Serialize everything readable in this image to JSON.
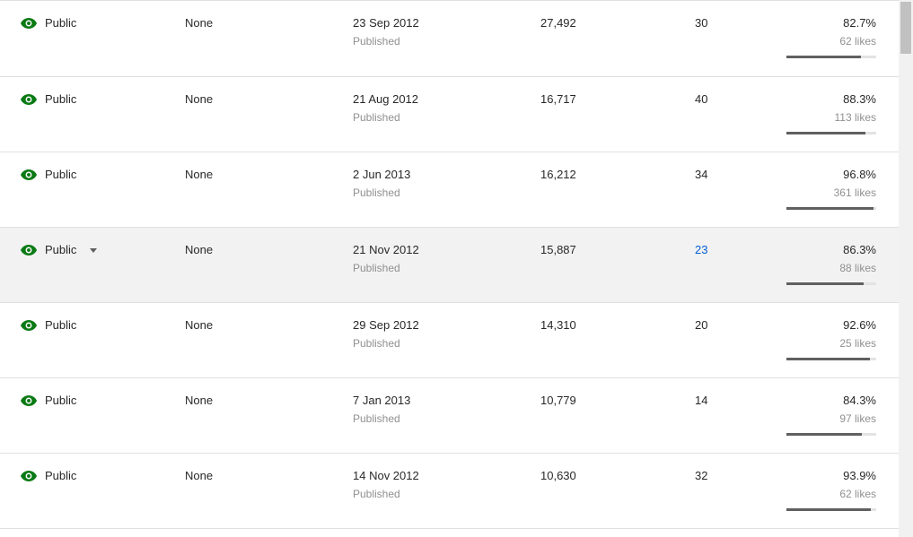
{
  "colors": {
    "visibility_icon": "#0b7a15",
    "link": "#065fd4",
    "hover_row": "#f2f2f2"
  },
  "rows": [
    {
      "visibility": "Public",
      "restrictions": "None",
      "date": "23 Sep 2012",
      "status": "Published",
      "views": "27,492",
      "comments": "30",
      "likes_pct": "82.7%",
      "likes_count": "62 likes",
      "ratio": 0.827
    },
    {
      "visibility": "Public",
      "restrictions": "None",
      "date": "21 Aug 2012",
      "status": "Published",
      "views": "16,717",
      "comments": "40",
      "likes_pct": "88.3%",
      "likes_count": "113 likes",
      "ratio": 0.883
    },
    {
      "visibility": "Public",
      "restrictions": "None",
      "date": "2 Jun 2013",
      "status": "Published",
      "views": "16,212",
      "comments": "34",
      "likes_pct": "96.8%",
      "likes_count": "361 likes",
      "ratio": 0.968
    },
    {
      "visibility": "Public",
      "restrictions": "None",
      "date": "21 Nov 2012",
      "status": "Published",
      "views": "15,887",
      "comments": "23",
      "likes_pct": "86.3%",
      "likes_count": "88 likes",
      "ratio": 0.863,
      "hovered": true
    },
    {
      "visibility": "Public",
      "restrictions": "None",
      "date": "29 Sep 2012",
      "status": "Published",
      "views": "14,310",
      "comments": "20",
      "likes_pct": "92.6%",
      "likes_count": "25 likes",
      "ratio": 0.926
    },
    {
      "visibility": "Public",
      "restrictions": "None",
      "date": "7 Jan 2013",
      "status": "Published",
      "views": "10,779",
      "comments": "14",
      "likes_pct": "84.3%",
      "likes_count": "97 likes",
      "ratio": 0.843
    },
    {
      "visibility": "Public",
      "restrictions": "None",
      "date": "14 Nov 2012",
      "status": "Published",
      "views": "10,630",
      "comments": "32",
      "likes_pct": "93.9%",
      "likes_count": "62 likes",
      "ratio": 0.939
    }
  ]
}
